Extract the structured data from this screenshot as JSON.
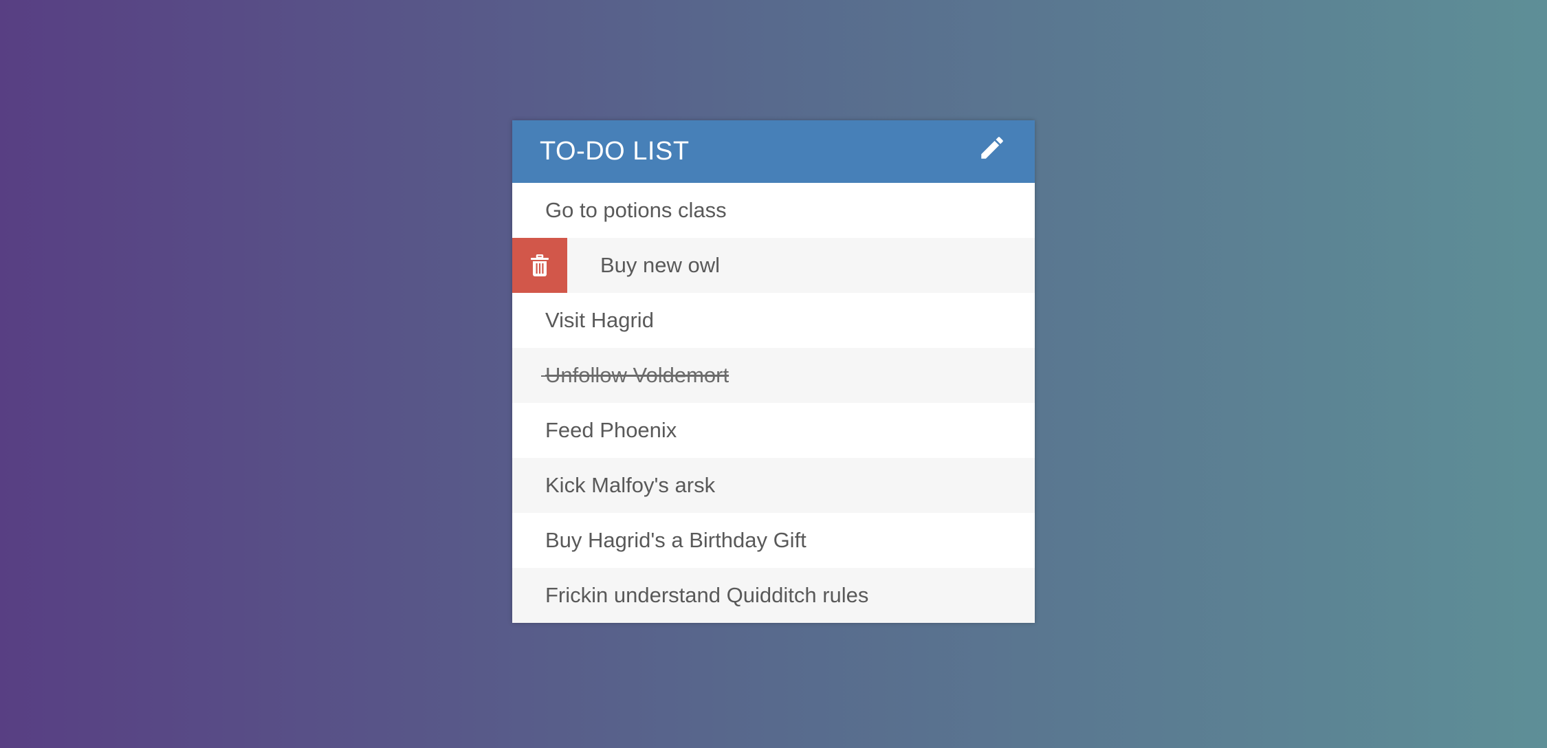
{
  "header": {
    "title": "TO-DO LIST",
    "edit_icon": "pencil-icon"
  },
  "colors": {
    "header_bg": "#4780b8",
    "delete_bg": "#d2574a",
    "gradient_start": "#583f83",
    "gradient_end": "#5e8f97"
  },
  "todos": [
    {
      "text": "Go to potions class",
      "done": false,
      "hover": false
    },
    {
      "text": "Buy new owl",
      "done": false,
      "hover": true,
      "delete_icon": "trash-icon"
    },
    {
      "text": "Visit Hagrid",
      "done": false,
      "hover": false
    },
    {
      "text": "Unfollow Voldemort",
      "done": true,
      "hover": false
    },
    {
      "text": "Feed Phoenix",
      "done": false,
      "hover": false
    },
    {
      "text": "Kick Malfoy's arsk",
      "done": false,
      "hover": false
    },
    {
      "text": "Buy Hagrid's a Birthday Gift",
      "done": false,
      "hover": false
    },
    {
      "text": "Frickin understand Quidditch rules",
      "done": false,
      "hover": false
    }
  ]
}
